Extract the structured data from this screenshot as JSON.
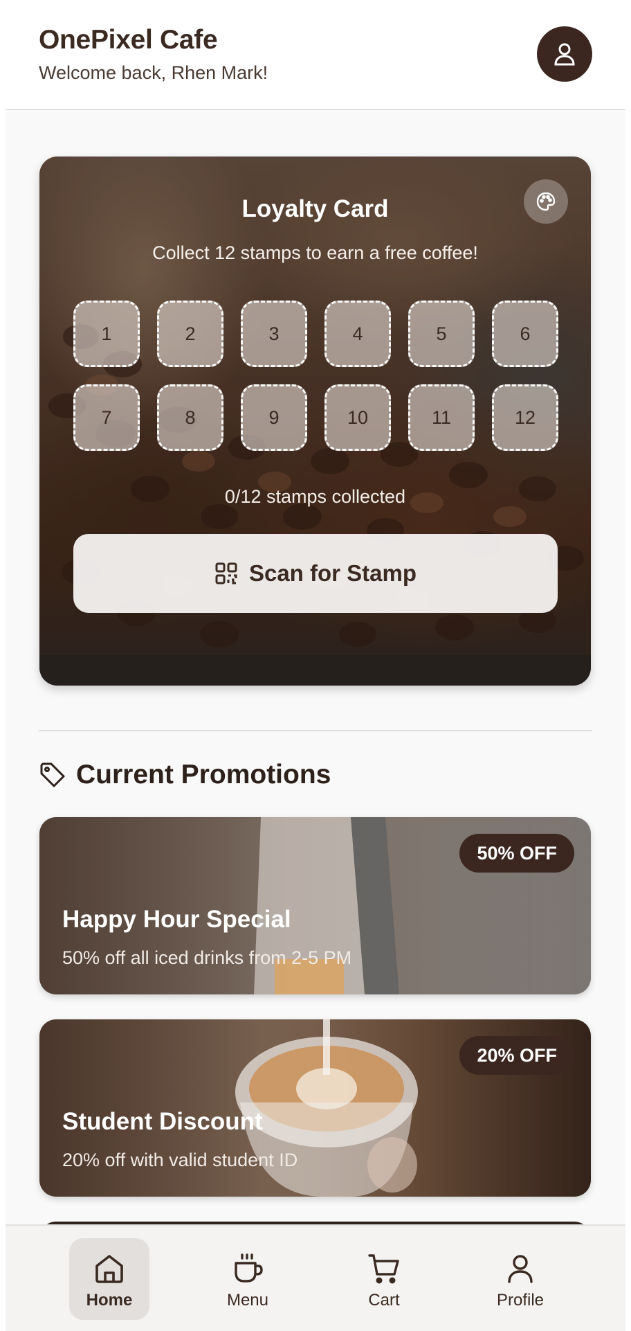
{
  "header": {
    "app_title": "OnePixel Cafe",
    "welcome": "Welcome back, Rhen Mark!",
    "avatar_icon": "user-icon"
  },
  "loyalty": {
    "title": "Loyalty Card",
    "subtitle": "Collect 12 stamps to earn a free coffee!",
    "stamps": [
      "1",
      "2",
      "3",
      "4",
      "5",
      "6",
      "7",
      "8",
      "9",
      "10",
      "11",
      "12"
    ],
    "collected": 0,
    "total": 12,
    "status": "0/12 stamps collected",
    "scan_label": "Scan for Stamp",
    "scan_icon": "qr-code-icon",
    "palette_icon": "palette-icon"
  },
  "promotions": {
    "heading": "Current Promotions",
    "heading_icon": "tag-icon",
    "items": [
      {
        "badge": "50% OFF",
        "title": "Happy Hour Special",
        "desc": "50% off all iced drinks from 2-5 PM"
      },
      {
        "badge": "20% OFF",
        "title": "Student Discount",
        "desc": "20% off with valid student ID"
      }
    ]
  },
  "nav": {
    "items": [
      {
        "label": "Home",
        "icon": "home-icon",
        "active": true
      },
      {
        "label": "Menu",
        "icon": "coffee-cup-icon",
        "active": false
      },
      {
        "label": "Cart",
        "icon": "cart-icon",
        "active": false
      },
      {
        "label": "Profile",
        "icon": "user-icon",
        "active": false
      }
    ]
  },
  "colors": {
    "brand_dark": "#3b2720",
    "background": "#f9f9f9",
    "text": "#3a2a22"
  }
}
